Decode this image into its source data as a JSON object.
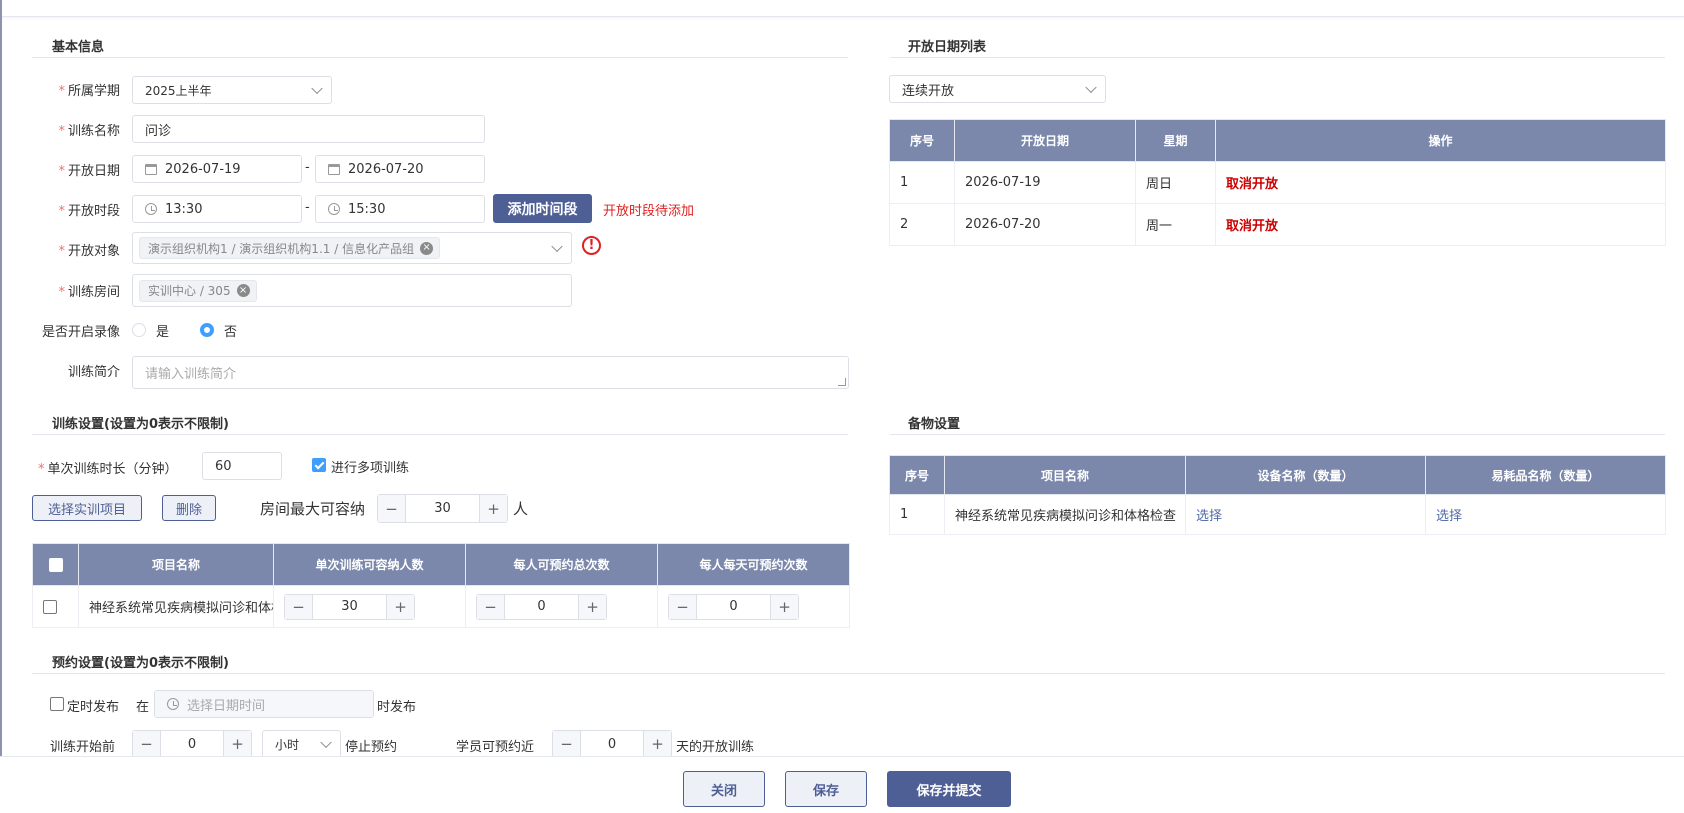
{
  "basic": {
    "title": "基本信息",
    "semester": {
      "label": "所属学期",
      "value": "2025上半年"
    },
    "name": {
      "label": "训练名称",
      "value": "问诊"
    },
    "open_date": {
      "label": "开放日期",
      "start": "2026-07-19",
      "end": "2026-07-20",
      "sep": "-"
    },
    "open_time": {
      "label": "开放时段",
      "start": "13:30",
      "end": "15:30",
      "sep": "-",
      "add_button": "添加时间段",
      "error": "开放时段待添加"
    },
    "target": {
      "label": "开放对象",
      "tag": "演示组织机构1 / 演示组织机构1.1 / 信息化产品组",
      "warn": "!"
    },
    "room": {
      "label": "训练房间",
      "tag": "实训中心 / 305"
    },
    "record": {
      "label": "是否开启录像",
      "yes": "是",
      "no": "否",
      "selected": "否"
    },
    "intro": {
      "label": "训练简介",
      "placeholder": "请输入训练简介"
    }
  },
  "open_list": {
    "title": "开放日期列表",
    "mode": "连续开放",
    "headers": [
      "序号",
      "开放日期",
      "星期",
      "操作"
    ],
    "rows": [
      {
        "idx": "1",
        "date": "2026-07-19",
        "week": "周日",
        "action": "取消开放"
      },
      {
        "idx": "2",
        "date": "2026-07-20",
        "week": "周一",
        "action": "取消开放"
      }
    ]
  },
  "training": {
    "title": "训练设置(设置为0表示不限制)",
    "duration_label": "单次训练时长（分钟）",
    "duration_value": "60",
    "multi_label": "进行多项训练",
    "select_button": "选择实训项目",
    "delete_button": "删除",
    "capacity_label": "房间最大可容纳",
    "capacity_value": "30",
    "capacity_unit": "人",
    "headers": [
      "项目名称",
      "单次训练可容纳人数",
      "每人可预约总次数",
      "每人每天可预约次数"
    ],
    "rows": [
      {
        "name": "神经系统常见疾病模拟问诊和体格检查",
        "cap": "30",
        "total": "0",
        "daily": "0"
      }
    ]
  },
  "supplies": {
    "title": "备物设置",
    "headers": [
      "序号",
      "项目名称",
      "设备名称（数量）",
      "易耗品名称（数量）"
    ],
    "rows": [
      {
        "idx": "1",
        "name": "神经系统常见疾病模拟问诊和体格检查",
        "device": "选择",
        "consumable": "选择"
      }
    ]
  },
  "booking": {
    "title": "预约设置(设置为0表示不限制)",
    "timed_label": "定时发布",
    "at": "在",
    "datetime_placeholder": "选择日期时间",
    "publish_suffix": "时发布",
    "before_label": "训练开始前",
    "before_value": "0",
    "unit": "小时",
    "stop_label": "停止预约",
    "near_label": "学员可预约近",
    "near_value": "0",
    "near_suffix": "天的开放训练"
  },
  "footer": {
    "close": "关闭",
    "save": "保存",
    "submit": "保存并提交"
  },
  "stepper": {
    "minus": "−",
    "plus": "+"
  }
}
